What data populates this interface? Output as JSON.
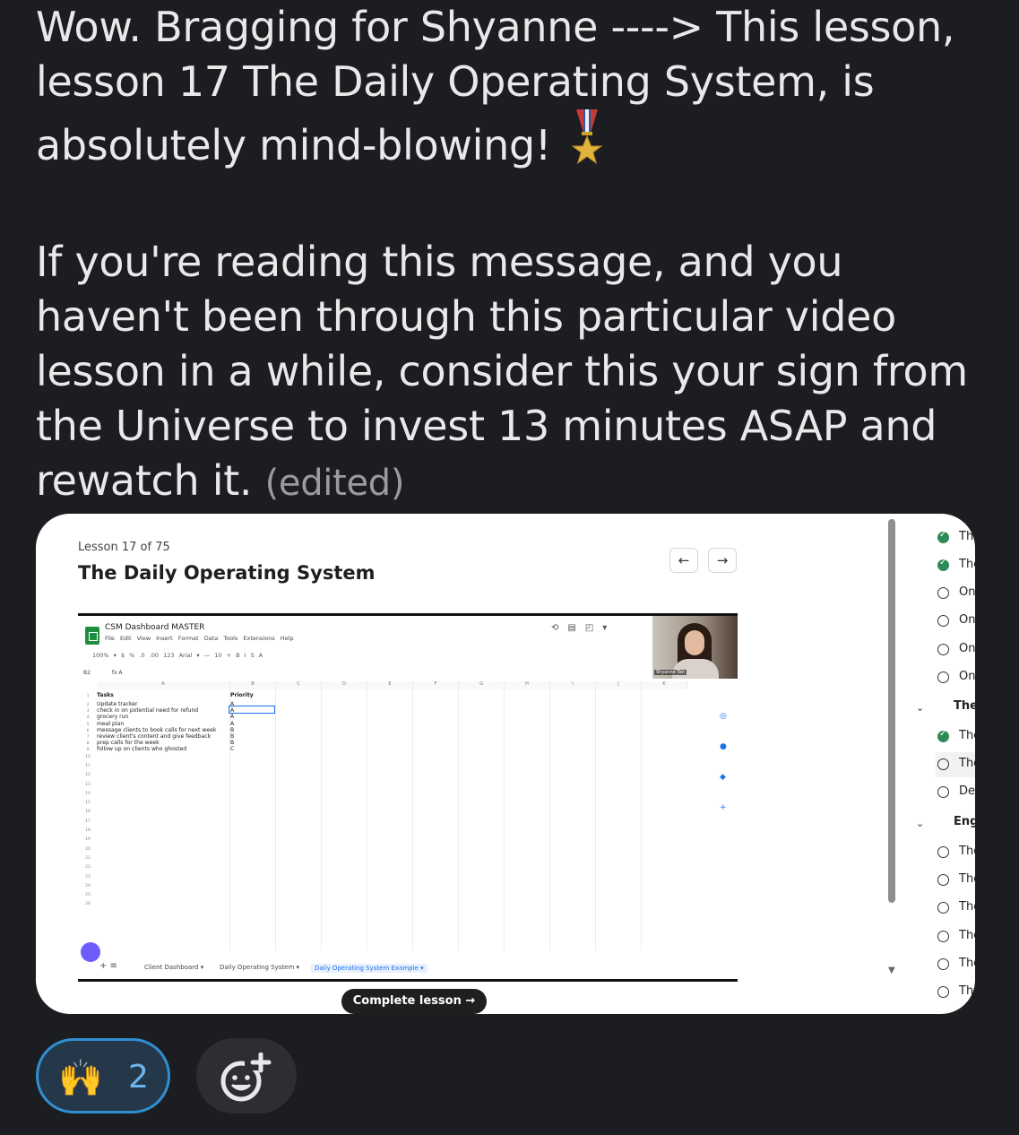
{
  "message": {
    "line1": "Wow. Bragging for Shyanne ----> This lesson, lesson 17 The Daily Operating System, is absolutely mind-blowing!",
    "line2": "If you're reading this message, and you haven't been through this particular video lesson in a while, consider this your sign from the Universe to invest 13 minutes ASAP and rewatch it.",
    "edited": "(edited)",
    "medal_icon": "military-medal-icon"
  },
  "lesson": {
    "counter": "Lesson 17 of 75",
    "title": "The Daily Operating System",
    "prev": "←",
    "next": "→",
    "complete_button": "Complete lesson →"
  },
  "sheet": {
    "doc_name": "CSM Dashboard MASTER",
    "menu": "File Edit View Insert Format Data Tools Extensions Help",
    "toolbar": "100% ▾  $  %  .0  .00  123  Arial ▾  —  10  +  B  I  S  A",
    "cell_ref": "B2",
    "formula": "fx  A",
    "columns": [
      "A",
      "B",
      "C",
      "D",
      "E",
      "F",
      "G",
      "H",
      "I",
      "J",
      "K"
    ],
    "header_row": {
      "a": "Tasks",
      "b": "Priority"
    },
    "rows": [
      {
        "a": "Update tracker",
        "b": "A"
      },
      {
        "a": "check in on potential need for refund",
        "b": "A"
      },
      {
        "a": "grocery run",
        "b": "A"
      },
      {
        "a": "meal plan",
        "b": "A"
      },
      {
        "a": "message clients to book calls for next week",
        "b": "B"
      },
      {
        "a": "review client's content and give feedback",
        "b": "B"
      },
      {
        "a": "prep calls for the week",
        "b": "B"
      },
      {
        "a": "follow up on clients who ghosted",
        "b": "C"
      }
    ],
    "tabs": [
      "Client Dashboard ▾",
      "Daily Operating System ▾",
      "Daily Operating System Example ▾"
    ],
    "presenter": "Shyanne Tan"
  },
  "sidebar": {
    "items": [
      {
        "text": "Th",
        "state": "done"
      },
      {
        "text": "The",
        "state": "done"
      },
      {
        "text": "On",
        "state": "open"
      },
      {
        "text": "On",
        "state": "open"
      },
      {
        "text": "On",
        "state": "open"
      },
      {
        "text": "On",
        "state": "open"
      },
      {
        "text": "The Cli",
        "state": "section"
      },
      {
        "text": "The",
        "state": "done"
      },
      {
        "text": "The",
        "state": "open"
      },
      {
        "text": "De",
        "state": "open"
      },
      {
        "text": "Engage",
        "state": "section"
      },
      {
        "text": "The",
        "state": "open"
      },
      {
        "text": "The",
        "state": "open"
      },
      {
        "text": "The",
        "state": "open"
      },
      {
        "text": "The",
        "state": "open"
      },
      {
        "text": "The",
        "state": "open"
      },
      {
        "text": "Th",
        "state": "open"
      }
    ]
  },
  "reactions": {
    "emoji": "🙌",
    "count": "2",
    "add_icon": "add-reaction-icon"
  }
}
